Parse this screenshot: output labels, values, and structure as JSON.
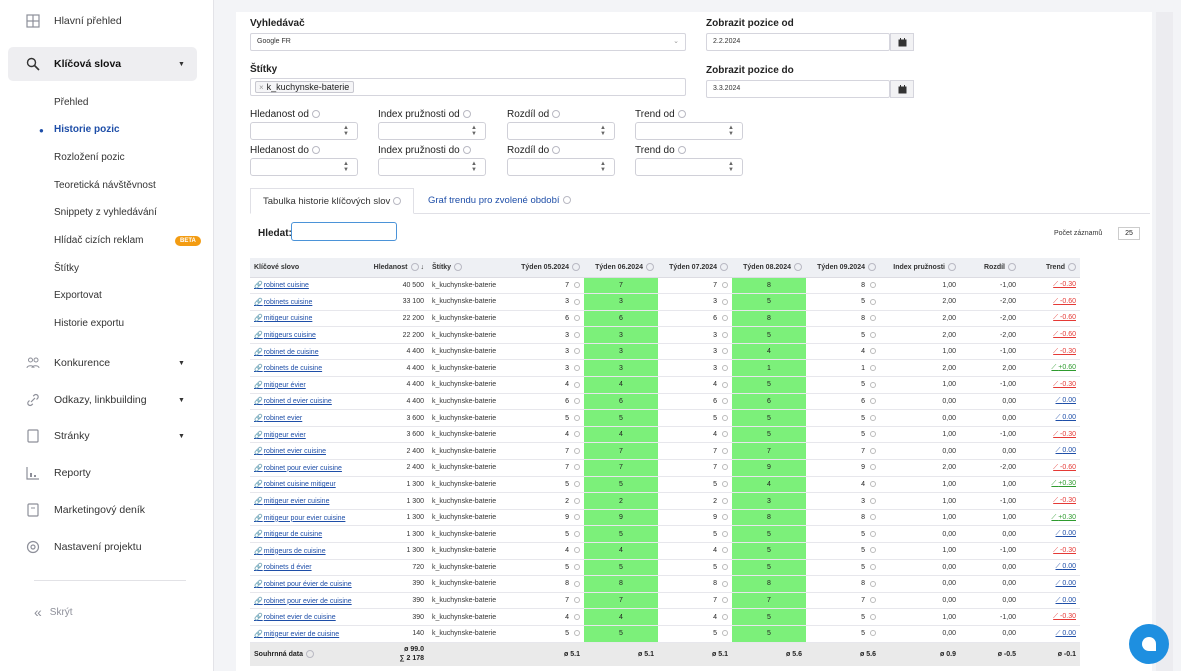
{
  "sidebar": {
    "items": [
      {
        "label": "Hlavní přehled",
        "icon": "dashboard-icon"
      },
      {
        "label": "Klíčová slova",
        "icon": "search-icon"
      },
      {
        "label": "Konkurence",
        "icon": "competitors-icon"
      },
      {
        "label": "Odkazy, linkbuilding",
        "icon": "link-icon"
      },
      {
        "label": "Stránky",
        "icon": "page-icon"
      },
      {
        "label": "Reporty",
        "icon": "reports-icon"
      },
      {
        "label": "Marketingový deník",
        "icon": "diary-icon"
      },
      {
        "label": "Nastavení projektu",
        "icon": "settings-icon"
      }
    ],
    "subitems": [
      "Přehled",
      "Historie pozic",
      "Rozložení pozic",
      "Teoretická návštěvnost",
      "Snippety z vyhledávání",
      "Hlídač cizích reklam",
      "Štítky",
      "Exportovat",
      "Historie exportu"
    ],
    "beta": "BETA",
    "hide": "Skrýt"
  },
  "filters": {
    "engine_label": "Vyhledávač",
    "engine_value": "Google FR",
    "tags_label": "Štítky",
    "tag_value": "k_kuchynske-baterie",
    "from_label": "Zobrazit pozice od",
    "from_value": "2.2.2024",
    "to_label": "Zobrazit pozice do",
    "to_value": "3.3.2024",
    "row1": [
      "Hledanost od",
      "Index pružnosti od",
      "Rozdíl od",
      "Trend od"
    ],
    "row2": [
      "Hledanost do",
      "Index pružnosti do",
      "Rozdíl do",
      "Trend do"
    ]
  },
  "tabs": [
    "Tabulka historie klíčových slov",
    "Graf trendu pro zvolené období"
  ],
  "search_label": "Hledat:",
  "records_label": "Počet záznamů",
  "records_value": "25",
  "table": {
    "headers": [
      "Klíčové slovo",
      "Hledanost",
      "Štítky",
      "Týden 05.2024",
      "Týden 06.2024",
      "Týden 07.2024",
      "Týden 08.2024",
      "Týden 09.2024",
      "Index pružnosti",
      "Rozdíl",
      "Trend"
    ],
    "rows": [
      [
        "robinet cuisine",
        "40 500",
        "k_kuchynske-baterie",
        "7",
        "7",
        "7",
        "8",
        "8",
        "1,00",
        "-1,00",
        "-0.30"
      ],
      [
        "robinets cuisine",
        "33 100",
        "k_kuchynske-baterie",
        "3",
        "3",
        "3",
        "5",
        "5",
        "2,00",
        "-2,00",
        "-0.60"
      ],
      [
        "mitigeur cuisine",
        "22 200",
        "k_kuchynske-baterie",
        "6",
        "6",
        "6",
        "8",
        "8",
        "2,00",
        "-2,00",
        "-0.60"
      ],
      [
        "mitigeurs cuisine",
        "22 200",
        "k_kuchynske-baterie",
        "3",
        "3",
        "3",
        "5",
        "5",
        "2,00",
        "-2,00",
        "-0.60"
      ],
      [
        "robinet de cuisine",
        "4 400",
        "k_kuchynske-baterie",
        "3",
        "3",
        "3",
        "4",
        "4",
        "1,00",
        "-1,00",
        "-0.30"
      ],
      [
        "robinets de cuisine",
        "4 400",
        "k_kuchynske-baterie",
        "3",
        "3",
        "3",
        "1",
        "1",
        "2,00",
        "2,00",
        "+0.60"
      ],
      [
        "mitigeur évier",
        "4 400",
        "k_kuchynske-baterie",
        "4",
        "4",
        "4",
        "5",
        "5",
        "1,00",
        "-1,00",
        "-0.30"
      ],
      [
        "robinet d evier cuisine",
        "4 400",
        "k_kuchynske-baterie",
        "6",
        "6",
        "6",
        "6",
        "6",
        "0,00",
        "0,00",
        "0.00"
      ],
      [
        "robinet evier",
        "3 600",
        "k_kuchynske-baterie",
        "5",
        "5",
        "5",
        "5",
        "5",
        "0,00",
        "0,00",
        "0.00"
      ],
      [
        "mitigeur evier",
        "3 600",
        "k_kuchynske-baterie",
        "4",
        "4",
        "4",
        "5",
        "5",
        "1,00",
        "-1,00",
        "-0.30"
      ],
      [
        "robinet evier cuisine",
        "2 400",
        "k_kuchynske-baterie",
        "7",
        "7",
        "7",
        "7",
        "7",
        "0,00",
        "0,00",
        "0.00"
      ],
      [
        "robinet pour evier cuisine",
        "2 400",
        "k_kuchynske-baterie",
        "7",
        "7",
        "7",
        "9",
        "9",
        "2,00",
        "-2,00",
        "-0.60"
      ],
      [
        "robinet cuisine mitigeur",
        "1 300",
        "k_kuchynske-baterie",
        "5",
        "5",
        "5",
        "4",
        "4",
        "1,00",
        "1,00",
        "+0.30"
      ],
      [
        "mitigeur evier cuisine",
        "1 300",
        "k_kuchynske-baterie",
        "2",
        "2",
        "2",
        "3",
        "3",
        "1,00",
        "-1,00",
        "-0.30"
      ],
      [
        "mitigeur pour evier cuisine",
        "1 300",
        "k_kuchynske-baterie",
        "9",
        "9",
        "9",
        "8",
        "8",
        "1,00",
        "1,00",
        "+0.30"
      ],
      [
        "mitigeur de cuisine",
        "1 300",
        "k_kuchynske-baterie",
        "5",
        "5",
        "5",
        "5",
        "5",
        "0,00",
        "0,00",
        "0.00"
      ],
      [
        "mitigeurs de cuisine",
        "1 300",
        "k_kuchynske-baterie",
        "4",
        "4",
        "4",
        "5",
        "5",
        "1,00",
        "-1,00",
        "-0.30"
      ],
      [
        "robinets d évier",
        "720",
        "k_kuchynske-baterie",
        "5",
        "5",
        "5",
        "5",
        "5",
        "0,00",
        "0,00",
        "0.00"
      ],
      [
        "robinet pour évier de cuisine",
        "390",
        "k_kuchynske-baterie",
        "8",
        "8",
        "8",
        "8",
        "8",
        "0,00",
        "0,00",
        "0.00"
      ],
      [
        "robinet pour evier de cuisine",
        "390",
        "k_kuchynske-baterie",
        "7",
        "7",
        "7",
        "7",
        "7",
        "0,00",
        "0,00",
        "0.00"
      ],
      [
        "robinet evier de cuisine",
        "390",
        "k_kuchynske-baterie",
        "4",
        "4",
        "4",
        "5",
        "5",
        "1,00",
        "-1,00",
        "-0.30"
      ],
      [
        "mitigeur evier de cuisine",
        "140",
        "k_kuchynske-baterie",
        "5",
        "5",
        "5",
        "5",
        "5",
        "0,00",
        "0,00",
        "0.00"
      ]
    ],
    "summary": {
      "label": "Souhrnná data",
      "avg_search": "ø 99.0",
      "sum_search": "∑ 2 178",
      "w05": "ø 5.1",
      "w06": "ø 5.1",
      "w07": "ø 5.1",
      "w08": "ø 5.6",
      "w09": "ø 5.6",
      "index": "ø 0.9",
      "diff": "ø -0.5",
      "trend": "ø -0.1"
    }
  },
  "colors": {
    "accent": "#1e4ea8",
    "highlight": "#7cf07a",
    "trend_down": "#e53935",
    "trend_up": "#2e9b2e",
    "beta": "#f39c12",
    "chat": "#1e8fe0"
  }
}
